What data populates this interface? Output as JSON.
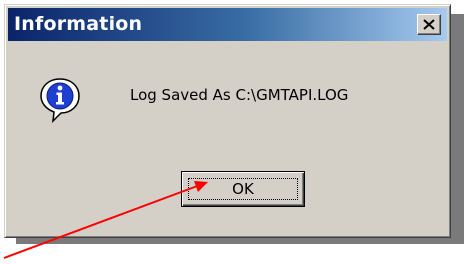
{
  "window": {
    "title": "Information",
    "close_icon": "close-icon"
  },
  "message": {
    "icon": "info-icon",
    "text": "Log Saved As C:\\GMTAPI.LOG"
  },
  "buttons": {
    "ok_label": "OK"
  },
  "annotation": {
    "arrow_color": "#ff0000"
  },
  "colors": {
    "dialog_face": "#d4d0c8",
    "titlebar_start": "#0a246a",
    "titlebar_end": "#a6caf0"
  }
}
